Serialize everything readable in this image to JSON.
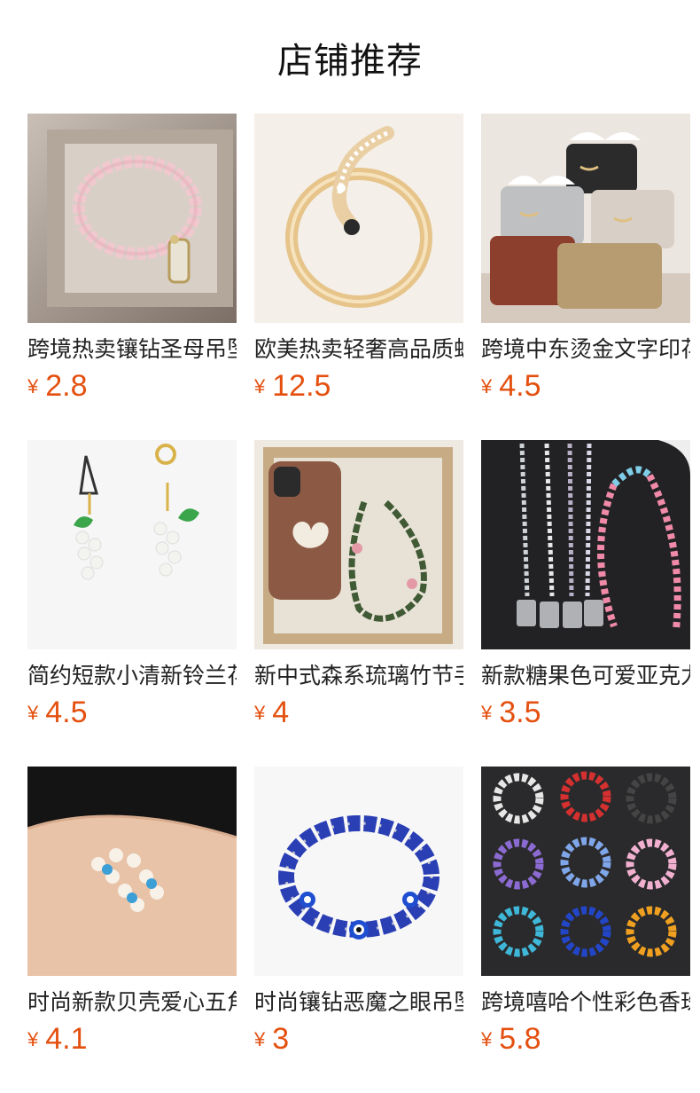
{
  "header": {
    "title": "店铺推荐"
  },
  "currency_symbol": "¥",
  "colors": {
    "price": "#e4500f",
    "title": "#111111",
    "name": "#222222"
  },
  "products": [
    {
      "name": "跨境热卖镶钻圣母吊坠手链",
      "price": "2.8",
      "image": "pink-crystal-bracelet"
    },
    {
      "name": "欧美热卖轻奢高品质蛇形手镯",
      "price": "12.5",
      "image": "gold-snake-bangle"
    },
    {
      "name": "跨境中东烫金文字印花纸巾盒",
      "price": "4.5",
      "image": "leather-tissue-boxes"
    },
    {
      "name": "简约短款小清新铃兰花手机挂绳",
      "price": "4.5",
      "image": "lily-of-valley-charms"
    },
    {
      "name": "新中式森系琉璃竹节手机链",
      "price": "4",
      "image": "bamboo-phone-chain"
    },
    {
      "name": "新款糖果色可爱亚克力手机挂绳",
      "price": "3.5",
      "image": "candy-phone-lanyards"
    },
    {
      "name": "时尚新款贝壳爱心五角星手链",
      "price": "4.1",
      "image": "shell-star-bracelets"
    },
    {
      "name": "时尚镶钻恶魔之眼吊坠手链",
      "price": "3",
      "image": "evil-eye-bracelet"
    },
    {
      "name": "跨境嘻哈个性彩色香珠手链",
      "price": "5.8",
      "image": "colorful-bead-bracelets"
    }
  ]
}
